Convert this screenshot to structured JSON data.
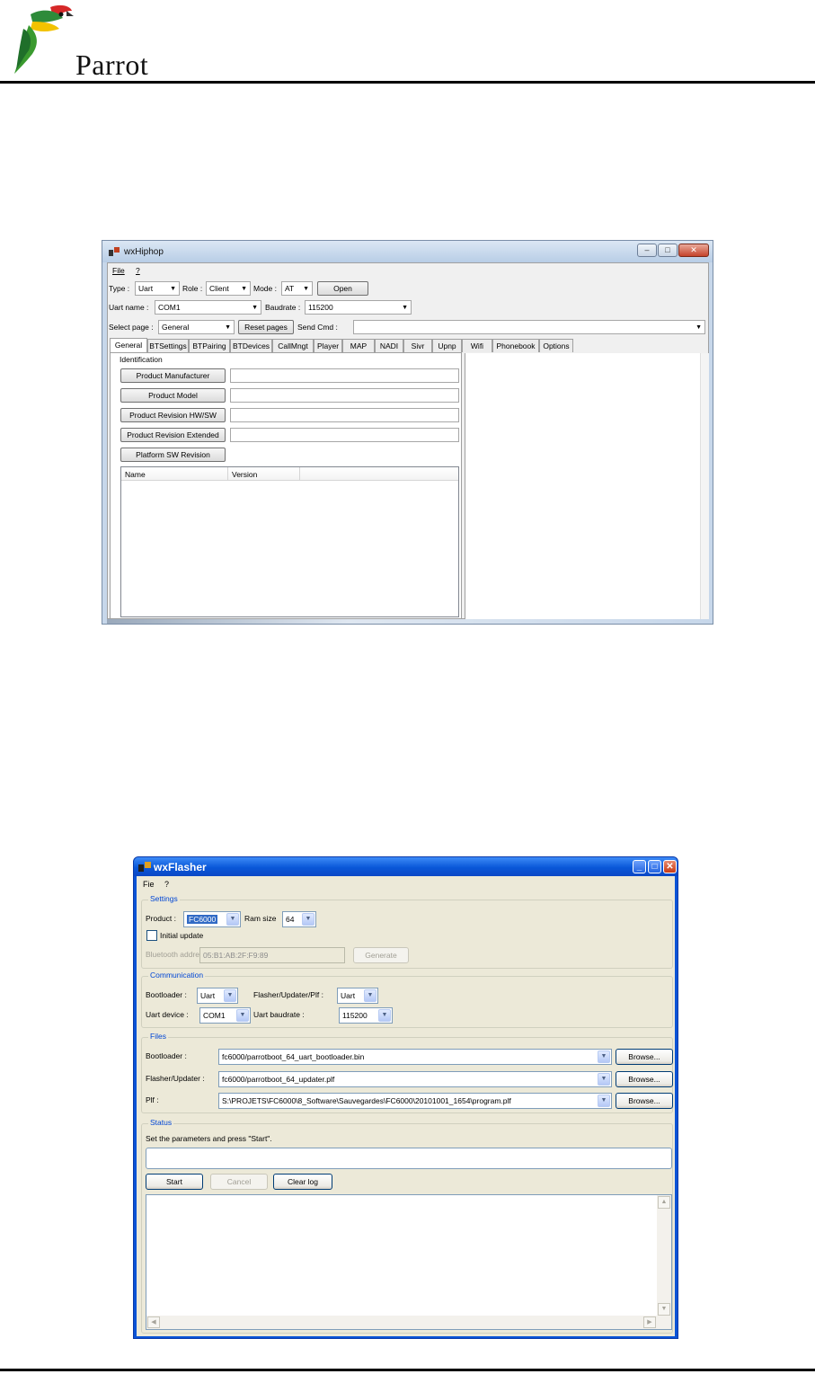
{
  "page": {
    "brand_name": "Parrot"
  },
  "hiphop": {
    "title": "wxHiphop",
    "menu": [
      "File",
      "?"
    ],
    "type_label": "Type :",
    "type_value": "Uart",
    "role_label": "Role :",
    "role_value": "Client",
    "mode_label": "Mode :",
    "mode_value": "AT",
    "open_label": "Open",
    "uart_name_label": "Uart name :",
    "uart_name_value": "COM1",
    "baudrate_label": "Baudrate :",
    "baudrate_value": "115200",
    "select_page_label": "Select page :",
    "select_page_value": "General",
    "reset_pages_label": "Reset pages",
    "send_cmd_label": "Send Cmd :",
    "send_cmd_value": "",
    "tabs": [
      "General",
      "BTSettings",
      "BTPairing",
      "BTDevices",
      "CallMngt",
      "Player",
      "MAP",
      "NADI",
      "Sivr",
      "Upnp",
      "Wifi",
      "Phonebook",
      "Options"
    ],
    "identification_label": "Identification",
    "buttons": [
      "Product Manufacturer",
      "Product Model",
      "Product Revision HW/SW",
      "Product Revision Extended",
      "Platform SW Revision"
    ],
    "list_columns": [
      "Name",
      "Version"
    ]
  },
  "flasher": {
    "title": "wxFlasher",
    "menu": [
      "Fie",
      "?"
    ],
    "settings": {
      "group_label": "Settings",
      "product_label": "Product :",
      "product_value": "FC6000",
      "ram_size_label": "Ram size",
      "ram_size_value": "64",
      "initial_update_label": "Initial update",
      "bt_address_label": "Bluetooth address :",
      "bt_address_value": "05:B1:AB:2F:F9:89",
      "generate_label": "Generate"
    },
    "communication": {
      "group_label": "Communication",
      "bootloader_label": "Bootloader :",
      "bootloader_value": "Uart",
      "flasher_label": "Flasher/Updater/Plf :",
      "flasher_value": "Uart",
      "uart_device_label": "Uart device :",
      "uart_device_value": "COM1",
      "uart_baudrate_label": "Uart baudrate :",
      "uart_baudrate_value": "115200"
    },
    "files": {
      "group_label": "Files",
      "rows": [
        {
          "label": "Bootloader :",
          "value": "fc6000/parrotboot_64_uart_bootloader.bin",
          "browse": "Browse..."
        },
        {
          "label": "Flasher/Updater :",
          "value": "fc6000/parrotboot_64_updater.plf",
          "browse": "Browse..."
        },
        {
          "label": "Plf :",
          "value": "S:\\PROJETS\\FC6000\\8_Software\\Sauvegardes\\FC6000\\20101001_1654\\program.plf",
          "browse": "Browse..."
        }
      ]
    },
    "status": {
      "group_label": "Status",
      "message": "Set the parameters and press \"Start\".",
      "start_label": "Start",
      "cancel_label": "Cancel",
      "clear_log_label": "Clear log"
    }
  }
}
